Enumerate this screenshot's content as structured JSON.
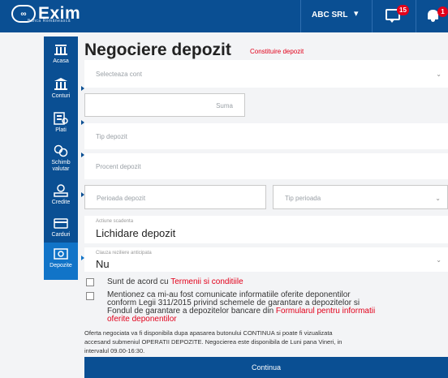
{
  "brand": {
    "name": "Exim",
    "tagline": "Banca Românească",
    "mark": "∞"
  },
  "header": {
    "company": "ABC SRL",
    "messages_badge": "15",
    "notifications_badge": "1"
  },
  "sidebar": {
    "items": [
      {
        "label": "Acasa",
        "icon": "home-icon"
      },
      {
        "label": "Conturi",
        "icon": "bank-icon"
      },
      {
        "label": "Plati",
        "icon": "payments-icon"
      },
      {
        "label": "Schimb valutar",
        "icon": "currency-exchange-icon"
      },
      {
        "label": "Credite",
        "icon": "credit-icon"
      },
      {
        "label": "Carduri",
        "icon": "card-icon"
      },
      {
        "label": "Depozite",
        "icon": "deposit-icon"
      }
    ]
  },
  "page": {
    "title": "Negociere depozit",
    "subtitle": "Constituire depozit"
  },
  "form": {
    "account_placeholder": "Selecteaza cont",
    "amount_placeholder": "Suma",
    "deposit_type_placeholder": "Tip depozit",
    "deposit_percent_placeholder": "Procent depozit",
    "deposit_period_placeholder": "Perioada depozit",
    "period_type_placeholder": "Tip perioada",
    "maturity_action_label": "Actiune scadenta",
    "maturity_action_value": "Lichidare depozit",
    "early_termination_label": "Clauza reziliere anticipata",
    "early_termination_value": "Nu",
    "agree_prefix": "Sunt de acord cu ",
    "agree_link": "Termenii si conditiile",
    "info_line1": "Mentionez ca mi-au fost comunicate informatiile oferite deponentilor",
    "info_line2": "conform Legii 311/2015 privind schemele de garantare a depozitelor si",
    "info_line3_prefix": "Fondul de garantare a depozitelor bancare din ",
    "info_line3_link": "Formularul pentru informatii",
    "info_line4_link": "oferite deponentilor",
    "note_line1": "Oferta negociata va fi disponibila dupa apasarea butonului CONTINUA si poate fi vizualizata",
    "note_line2": "accesand submeniul OPERATII DEPOZITE. Negocierea este disponibila de Luni pana Vineri, in",
    "note_line3": "intervalul 09.00-16:30.",
    "continue_button": "Continua"
  },
  "colors": {
    "brand_blue": "#0a4f93",
    "active_blue": "#1174c8",
    "accent_red": "#e2001a"
  }
}
